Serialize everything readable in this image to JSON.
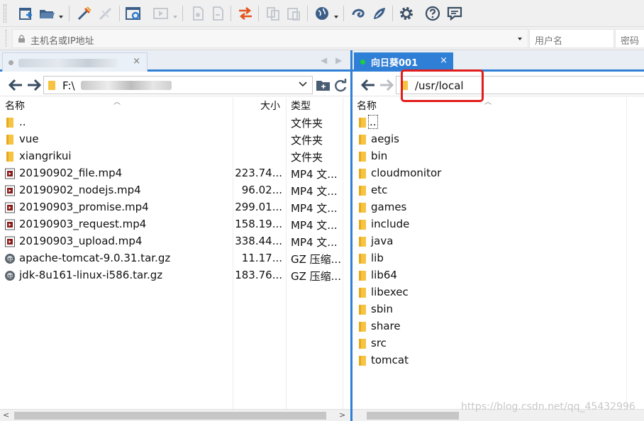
{
  "toolbar": {
    "icons": [
      "new-session-icon",
      "open-folder-icon",
      "connect-icon",
      "disconnect-icon",
      "settings-icon",
      "play-icon",
      "file-icon",
      "file-copy-icon",
      "transfer-icon",
      "copy-icon",
      "paste-icon",
      "globe-icon",
      "swirl-icon",
      "leaf-icon",
      "gear-icon",
      "help-icon",
      "chat-icon"
    ]
  },
  "address": {
    "host_placeholder": "主机名或IP地址",
    "user_placeholder": "用户名",
    "password_placeholder": "密码"
  },
  "left": {
    "tab_close": "×",
    "path_prefix": "F:\\",
    "columns": {
      "name": "名称",
      "size": "大小",
      "type": "类型"
    },
    "files": [
      {
        "name": "..",
        "size": "",
        "type": "文件夹",
        "icon": "folder-icon",
        "selected": false
      },
      {
        "name": "vue",
        "size": "",
        "type": "文件夹",
        "icon": "folder-icon",
        "selected": false
      },
      {
        "name": "xiangrikui",
        "size": "",
        "type": "文件夹",
        "icon": "folder-icon",
        "selected": true
      },
      {
        "name": "20190902_file.mp4",
        "size": "223.74...",
        "type": "MP4 文...",
        "icon": "video-file-icon",
        "selected": false
      },
      {
        "name": "20190902_nodejs.mp4",
        "size": "96.02...",
        "type": "MP4 文...",
        "icon": "video-file-icon",
        "selected": false
      },
      {
        "name": "20190903_promise.mp4",
        "size": "299.01...",
        "type": "MP4 文...",
        "icon": "video-file-icon",
        "selected": false
      },
      {
        "name": "20190903_request.mp4",
        "size": "158.19...",
        "type": "MP4 文...",
        "icon": "video-file-icon",
        "selected": false
      },
      {
        "name": "20190903_upload.mp4",
        "size": "338.44...",
        "type": "MP4 文...",
        "icon": "video-file-icon",
        "selected": false
      },
      {
        "name": "apache-tomcat-9.0.31.tar.gz",
        "size": "11.17...",
        "type": "GZ 压缩...",
        "icon": "archive-file-icon",
        "selected": false
      },
      {
        "name": "jdk-8u161-linux-i586.tar.gz",
        "size": "183.76...",
        "type": "GZ 压缩...",
        "icon": "archive-file-icon",
        "selected": false
      }
    ]
  },
  "right": {
    "tab_label": "向日葵001",
    "tab_close": "×",
    "path": "/usr/local",
    "columns": {
      "name": "名称"
    },
    "files": [
      {
        "name": "..",
        "icon": "folder-icon"
      },
      {
        "name": "aegis",
        "icon": "folder-icon"
      },
      {
        "name": "bin",
        "icon": "folder-icon"
      },
      {
        "name": "cloudmonitor",
        "icon": "folder-icon"
      },
      {
        "name": "etc",
        "icon": "folder-icon"
      },
      {
        "name": "games",
        "icon": "folder-icon"
      },
      {
        "name": "include",
        "icon": "folder-icon"
      },
      {
        "name": "java",
        "icon": "folder-icon"
      },
      {
        "name": "lib",
        "icon": "folder-icon"
      },
      {
        "name": "lib64",
        "icon": "folder-icon"
      },
      {
        "name": "libexec",
        "icon": "folder-icon"
      },
      {
        "name": "sbin",
        "icon": "folder-icon"
      },
      {
        "name": "share",
        "icon": "folder-icon"
      },
      {
        "name": "src",
        "icon": "folder-icon"
      },
      {
        "name": "tomcat",
        "icon": "folder-icon"
      }
    ]
  },
  "watermark": "https://blog.csdn.net/qq_45432996",
  "colors": {
    "accent": "#2f7fd6",
    "highlight": "#e21b1b",
    "folder": "#f6c343",
    "online": "#19d23a"
  }
}
